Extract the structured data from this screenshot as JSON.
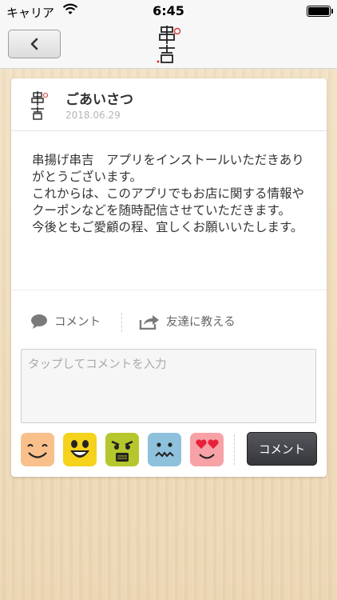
{
  "status_bar": {
    "carrier": "キャリア",
    "time": "6:45",
    "wifi_icon": "wifi-icon",
    "battery_level": 1.0
  },
  "nav": {
    "back_icon": "chevron-left-icon",
    "logo_text": "串吉"
  },
  "post": {
    "author_logo_text": "串吉",
    "title": "ごあいさつ",
    "date": "2018.06.29",
    "body": "串揚げ串吉　アプリをインストールいただきありがとうございます。\nこれからは、このアプリでもお店に関する情報やクーポンなどを随時配信させていただきます。\n今後ともご愛顧の程、宜しくお願いいたします。"
  },
  "actions": {
    "comment_label": "コメント",
    "comment_icon": "speech-bubble-icon",
    "share_label": "友達に教える",
    "share_icon": "share-arrow-icon"
  },
  "comment_form": {
    "placeholder": "タップしてコメントを入力",
    "submit_label": "コメント",
    "stamps": [
      {
        "name": "smile-stamp",
        "color": "#f9c08c"
      },
      {
        "name": "laugh-stamp",
        "color": "#f5d21c"
      },
      {
        "name": "angry-stamp",
        "color": "#b6c72d"
      },
      {
        "name": "sad-stamp",
        "color": "#8ec1dc"
      },
      {
        "name": "love-stamp",
        "color": "#f7a2a6"
      }
    ]
  }
}
